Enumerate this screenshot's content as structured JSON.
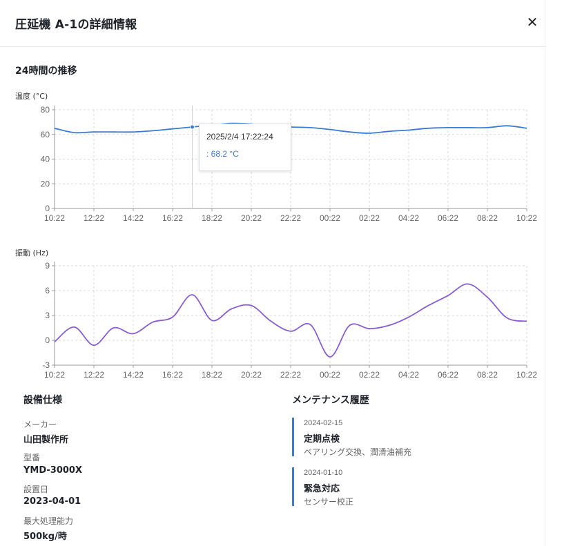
{
  "modal": {
    "title": "圧延機 A-1の詳細情報",
    "close_icon": "close-icon",
    "trend_title": "24時間の推移"
  },
  "charts": {
    "x_ticks": [
      "10:22",
      "12:22",
      "14:22",
      "16:22",
      "18:22",
      "20:22",
      "22:22",
      "00:22",
      "02:22",
      "04:22",
      "06:22",
      "08:22",
      "10:22"
    ],
    "temperature": {
      "label": "温度 (°C)",
      "y_ticks": [
        "0",
        "20",
        "40",
        "60",
        "80"
      ]
    },
    "vibration": {
      "label": "振動 (Hz)",
      "y_ticks": [
        "-3",
        "0",
        "3",
        "6",
        "9"
      ]
    }
  },
  "chart_data": [
    {
      "type": "line",
      "title": "温度 (°C)",
      "ylabel": "温度 (°C)",
      "ylim": [
        0,
        80
      ],
      "x": [
        0,
        1,
        2,
        3,
        4,
        5,
        6,
        7,
        8,
        9,
        10,
        11,
        12,
        13,
        14,
        15,
        16,
        17,
        18,
        19,
        20,
        21,
        22,
        23,
        24
      ],
      "series": [
        {
          "color": "#3a7bd5",
          "values": [
            65,
            61.5,
            62,
            62,
            62,
            63,
            64.5,
            66,
            67.5,
            69,
            68.5,
            67,
            66,
            65.5,
            64,
            62,
            61,
            62.5,
            63.5,
            65,
            65.5,
            65.5,
            65.5,
            67,
            65
          ]
        }
      ],
      "tooltip": {
        "x": 7,
        "time": "2025/2/4 17:22:24",
        "value_text": ": 68.2 °C"
      }
    },
    {
      "type": "line",
      "title": "振動 (Hz)",
      "ylabel": "振動 (Hz)",
      "ylim": [
        -3,
        9
      ],
      "x": [
        0,
        1,
        2,
        3,
        4,
        5,
        6,
        7,
        8,
        9,
        10,
        11,
        12,
        13,
        14,
        15,
        16,
        17,
        18,
        19,
        20,
        21,
        22,
        23,
        24
      ],
      "series": [
        {
          "color": "#8a5bd6",
          "values": [
            -0.2,
            1.6,
            -0.6,
            1.5,
            0.8,
            2.2,
            2.8,
            5.5,
            2.4,
            3.8,
            4.2,
            2.3,
            1.1,
            1.9,
            -2,
            1.8,
            1.4,
            1.8,
            2.8,
            4.2,
            5.4,
            6.8,
            5.2,
            2.7,
            2.3
          ]
        }
      ]
    }
  ],
  "specs": {
    "title": "設備仕様",
    "items": [
      {
        "label": "メーカー",
        "value": "山田製作所"
      },
      {
        "label": "型番",
        "value": "YMD-3000X"
      },
      {
        "label": "設置日",
        "value": "2023-04-01"
      },
      {
        "label": "最大処理能力",
        "value": "500kg/時"
      }
    ]
  },
  "maintenance": {
    "title": "メンテナンス履歴",
    "items": [
      {
        "date": "2024-02-15",
        "type": "定期点検",
        "desc": "ベアリング交換、潤滑油補充"
      },
      {
        "date": "2024-01-10",
        "type": "緊急対応",
        "desc": "センサー校正"
      }
    ]
  },
  "colors": {
    "accent": "#3a7bd5",
    "vibration": "#8a5bd6",
    "grid": "#d5d8dc"
  }
}
